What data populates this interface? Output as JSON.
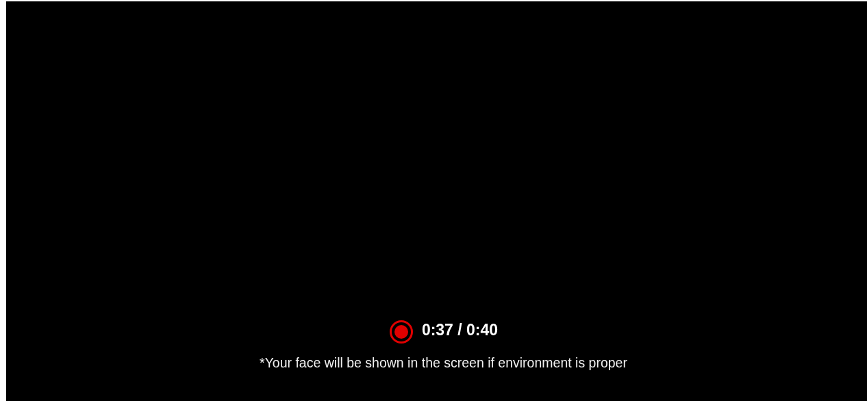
{
  "recorder": {
    "timer": "0:37 / 0:40",
    "note": "*Your face will be shown in the screen if environment is proper"
  }
}
